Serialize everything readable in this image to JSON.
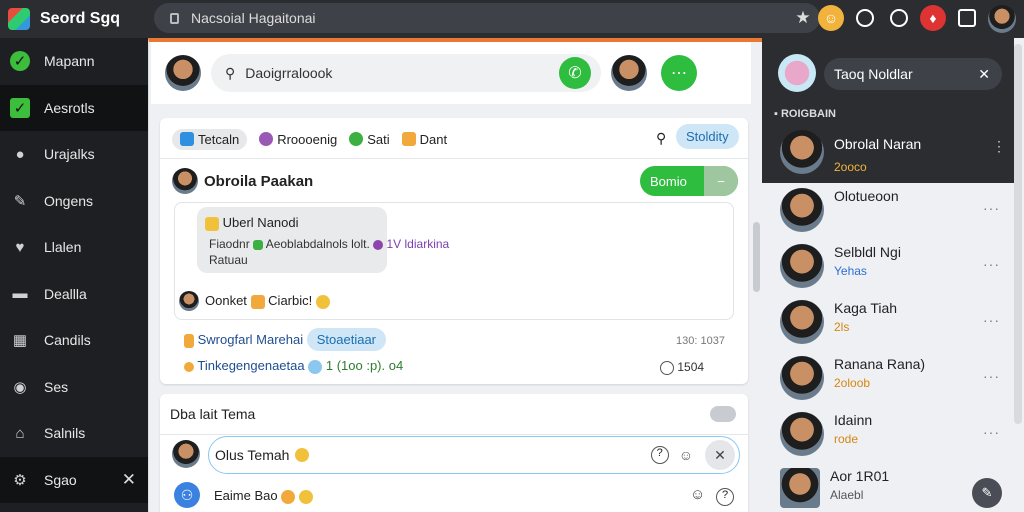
{
  "app": {
    "name": "Seord Sgq",
    "url": "Nacsoial Hagaitonai"
  },
  "sidebar": {
    "items": [
      {
        "label": "Mapann",
        "icon": "check-circle-icon"
      },
      {
        "label": "Aesrotls",
        "icon": "check-square-icon"
      },
      {
        "label": "Urajalks",
        "icon": "user-icon"
      },
      {
        "label": "Ongens",
        "icon": "wrench-icon"
      },
      {
        "label": "Llalen",
        "icon": "heart-icon"
      },
      {
        "label": "Deallla",
        "icon": "folder-icon"
      },
      {
        "label": "Candils",
        "icon": "chart-icon"
      },
      {
        "label": "Ses",
        "icon": "globe-icon"
      },
      {
        "label": "Salnils",
        "icon": "home-icon"
      },
      {
        "label": "Sgao",
        "icon": "settings-icon",
        "close": "✕"
      }
    ]
  },
  "header": {
    "search_text": "Daoigrraloook"
  },
  "filters": {
    "tabs": [
      "Tetcaln",
      "Rroooenig",
      "Sati",
      "Dant"
    ],
    "button": "Stoldity"
  },
  "post": {
    "author": "Obroila Paakan",
    "action": "Bomio",
    "bubble_title": "Uberl Nanodi",
    "bubble_line1": "Fiaodnr",
    "bubble_line2": "Aeoblabdalnols",
    "bubble_line3": "lolt.",
    "bubble_tag": "1V ldiarkina",
    "bubble_line4": "Ratuau",
    "reply_name": "Oonket",
    "reply_text": "Ciarbic!",
    "row1_name": "Swrogfarl Marehai",
    "row1_badge": "Stoaetiaar",
    "row1_time": "130:  1037",
    "row2_text": "Tinkegengenaetaa",
    "row2_meta": "1 (1oo  :p). o4",
    "row2_count": "1504"
  },
  "composer": {
    "title": "Dba lait Tema",
    "input": "Olus Temah",
    "input2": "Eaime Bao"
  },
  "right": {
    "search": "Taoq Noldlar",
    "section": "ROIGBAIN",
    "contacts": [
      {
        "name": "Obrolal Naran",
        "sub": "2ooco"
      },
      {
        "name": "Olotueoon",
        "sub": ""
      },
      {
        "name": "Selbldl Ngi",
        "sub": "Yehas"
      },
      {
        "name": "Kaga Tiah",
        "sub": "2ls"
      },
      {
        "name": "Ranana Rana)",
        "sub": "2oloob"
      },
      {
        "name": "Idainn",
        "sub": "rode"
      },
      {
        "name": "Aor 1R01",
        "sub": "Alaebl"
      }
    ]
  },
  "colors": {
    "accent_green": "#2ebd3e",
    "accent_orange": "#e97932",
    "dark": "#2b2d31"
  }
}
